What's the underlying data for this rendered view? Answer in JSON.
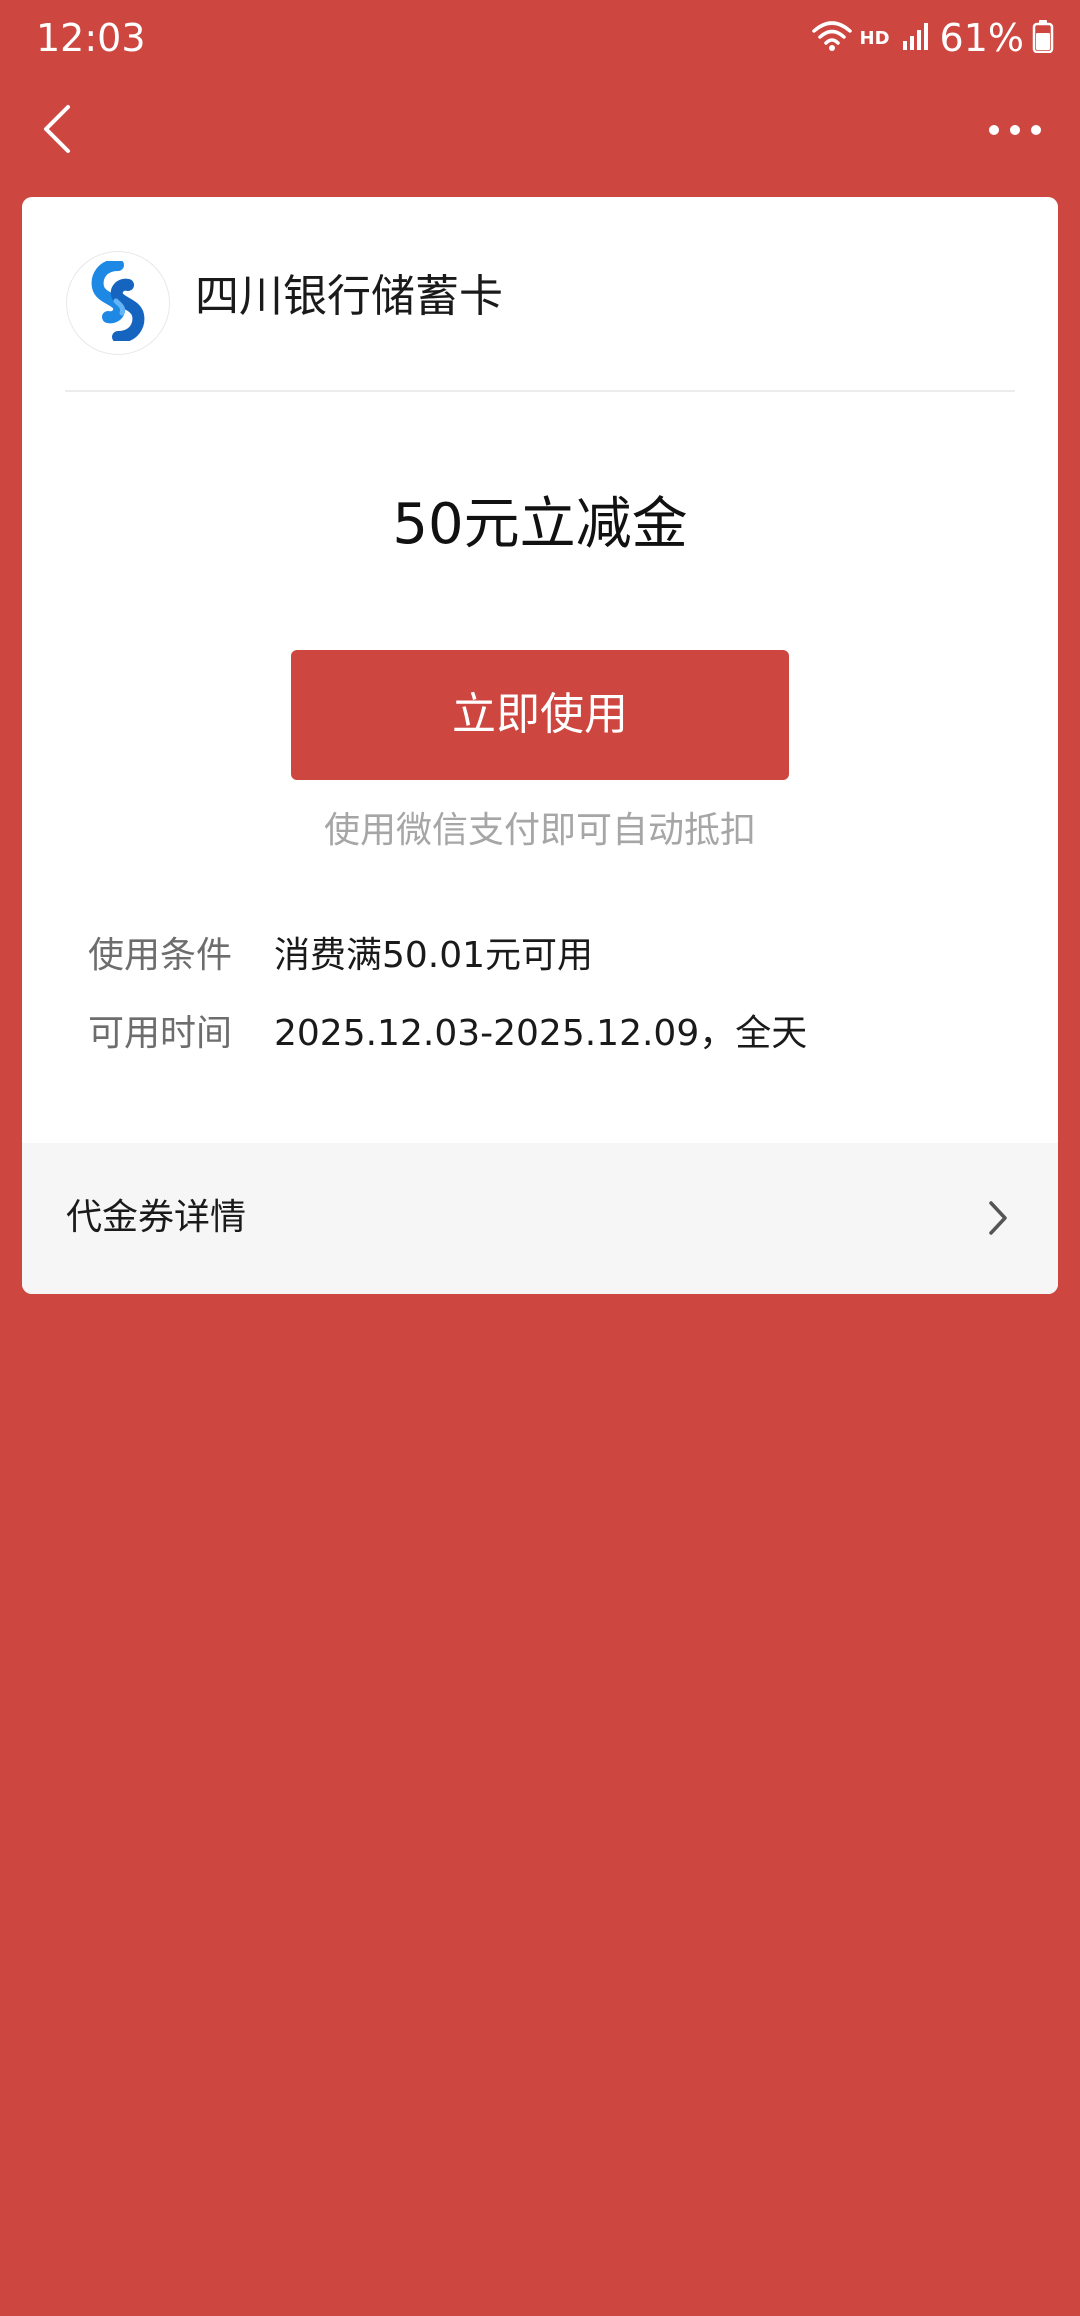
{
  "status_bar": {
    "time": "12:03",
    "network_label": "HD",
    "battery": "61%"
  },
  "header": {
    "back_icon": "chevron-left-icon",
    "more_icon": "more-horizontal-icon"
  },
  "card": {
    "bank_name": "四川银行储蓄卡",
    "coupon_title": "50元立减金",
    "use_button_label": "立即使用",
    "hint": "使用微信支付即可自动抵扣",
    "conditions": [
      {
        "label": "使用条件",
        "value": "消费满50.01元可用"
      },
      {
        "label": "可用时间",
        "value": "2025.12.03-2025.12.09，全天"
      }
    ],
    "details_label": "代金券详情"
  },
  "colors": {
    "brand_red": "#CD4640",
    "logo_blue": "#1E88E5"
  }
}
